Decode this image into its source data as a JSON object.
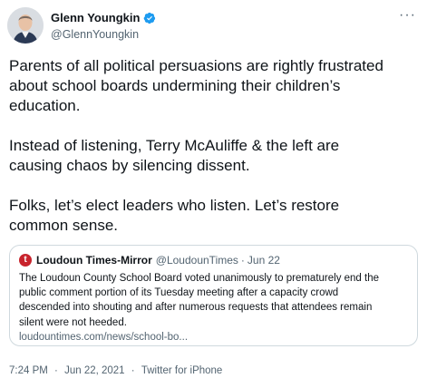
{
  "author": {
    "display_name": "Glenn Youngkin",
    "handle": "@GlennYoungkin",
    "verified_icon": "verified-badge-icon",
    "avatar": "profile-photo",
    "more_icon": "more-icon",
    "more_label": "···"
  },
  "tweet": {
    "paragraphs": [
      "Parents of all political persuasions are rightly frustrated\nabout school boards undermining their children’s\neducation.",
      "Instead of listening, Terry McAuliffe & the left are\ncausing chaos by silencing dissent.",
      "Folks, let’s elect leaders who listen. Let’s restore\ncommon sense."
    ]
  },
  "quote": {
    "logo_letter": "t",
    "name": "Loudoun Times-Mirror",
    "handle": "@LoudounTimes",
    "separator": "·",
    "time": "Jun 22",
    "text": "The Loudoun County School Board voted unanimously to prematurely end the\npublic comment portion of its Tuesday meeting after a capacity crowd\ndescended into shouting and after numerous requests that attendees remain\nsilent were not heeded.",
    "link": "loudountimes.com/news/school-bo..."
  },
  "meta": {
    "time": "7:24 PM",
    "separator": "·",
    "date": "Jun 22, 2021",
    "source": "Twitter for iPhone"
  },
  "colors": {
    "text": "#0f1419",
    "secondary": "#536471",
    "verified": "#1d9bf0",
    "border": "#cfd9de",
    "logo": "#c8232c"
  }
}
